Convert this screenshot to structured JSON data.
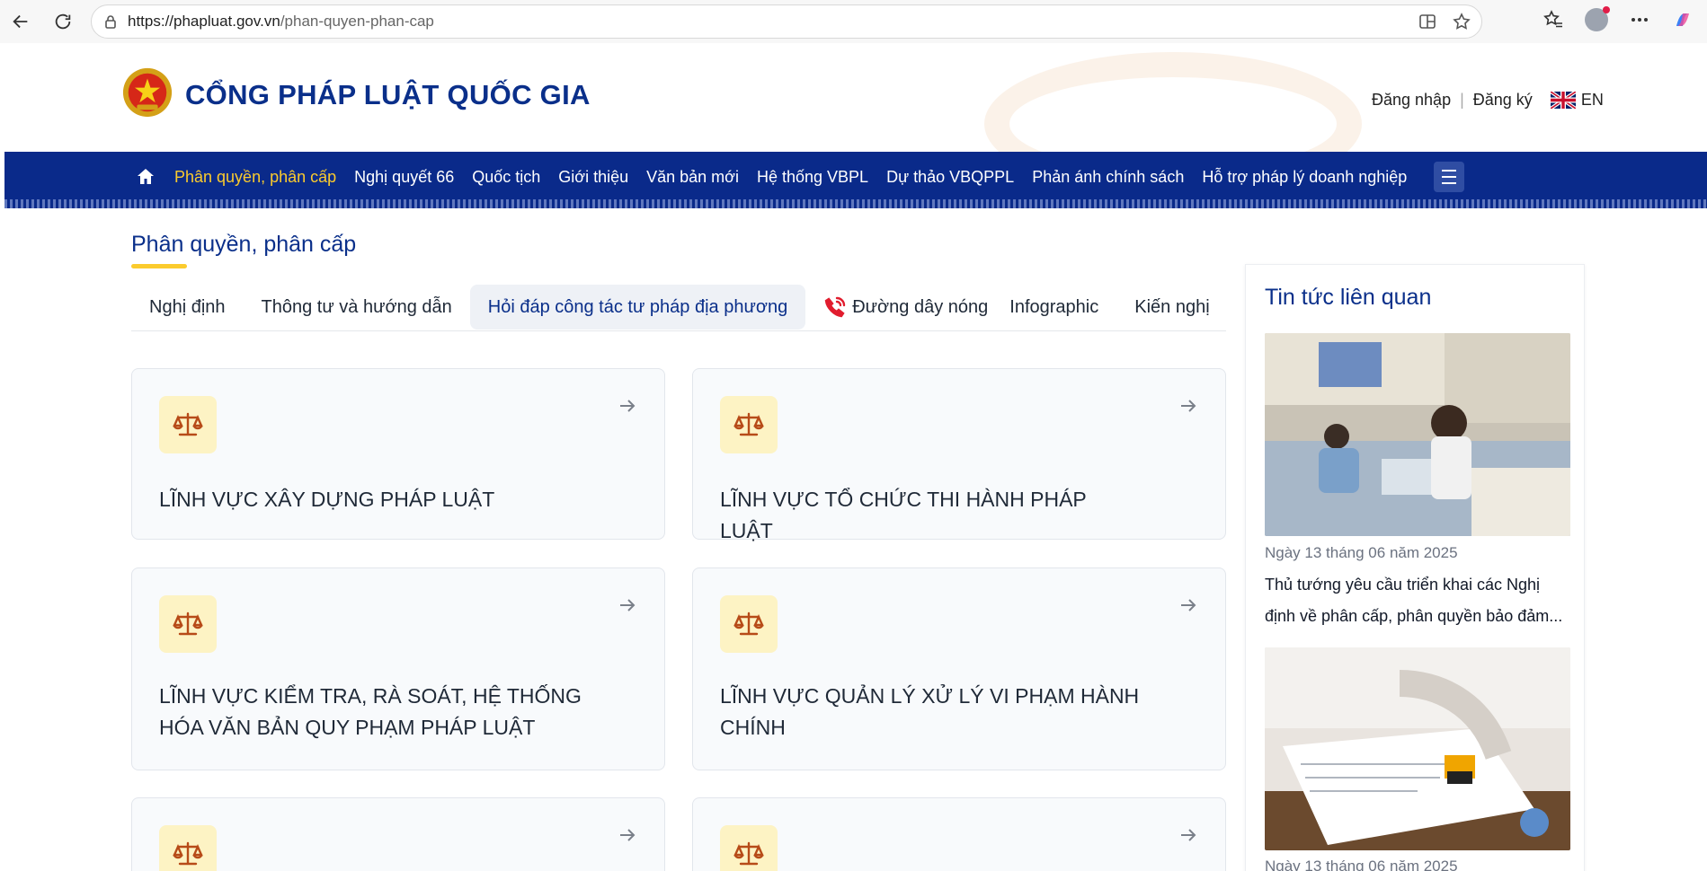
{
  "browser": {
    "url_domain": "https://phapluat.gov.vn",
    "url_path": "/phan-quyen-phan-cap"
  },
  "header": {
    "title": "CỔNG PHÁP LUẬT QUỐC GIA",
    "login": "Đăng nhập",
    "register": "Đăng ký",
    "lang": "EN"
  },
  "nav": {
    "items": [
      {
        "label": "Phân quyền, phân cấp",
        "active": true
      },
      {
        "label": "Nghị quyết 66"
      },
      {
        "label": "Quốc tịch"
      },
      {
        "label": "Giới thiệu"
      },
      {
        "label": "Văn bản mới"
      },
      {
        "label": "Hệ thống VBPL"
      },
      {
        "label": "Dự thảo VBQPPL"
      },
      {
        "label": "Phản ánh chính sách"
      },
      {
        "label": "Hỗ trợ pháp lý doanh nghiệp"
      }
    ]
  },
  "section": {
    "title": "Phân quyền, phân cấp",
    "tabs": [
      {
        "label": "Nghị định"
      },
      {
        "label": "Thông tư và hướng dẫn"
      },
      {
        "label": "Hỏi đáp công tác tư pháp địa phương",
        "active": true
      },
      {
        "label": "Đường dây nóng"
      },
      {
        "label": "Infographic"
      },
      {
        "label": "Kiến nghị"
      }
    ]
  },
  "cards": [
    {
      "title": "LĨNH VỰC XÂY DỰNG PHÁP LUẬT"
    },
    {
      "title": "LĨNH VỰC TỔ CHỨC THI HÀNH PHÁP LUẬT"
    },
    {
      "title": "LĨNH VỰC KIỂM TRA, RÀ SOÁT, HỆ THỐNG HÓA VĂN BẢN QUY PHẠM PHÁP LUẬT"
    },
    {
      "title": "LĨNH VỰC QUẢN LÝ XỬ LÝ VI PHẠM HÀNH CHÍNH"
    }
  ],
  "sidebar": {
    "title": "Tin tức liên quan",
    "news": [
      {
        "date": "Ngày 13 tháng 06 năm 2025",
        "title": "Thủ tướng yêu cầu triển khai các Nghị định về phân cấp, phân quyền bảo đảm..."
      },
      {
        "date": "Ngày 13 tháng 06 năm 2025"
      }
    ]
  },
  "colors": {
    "brand_blue": "#0a2a8a",
    "accent_yellow": "#fbcb2d",
    "icon_orange": "#b74b18"
  }
}
